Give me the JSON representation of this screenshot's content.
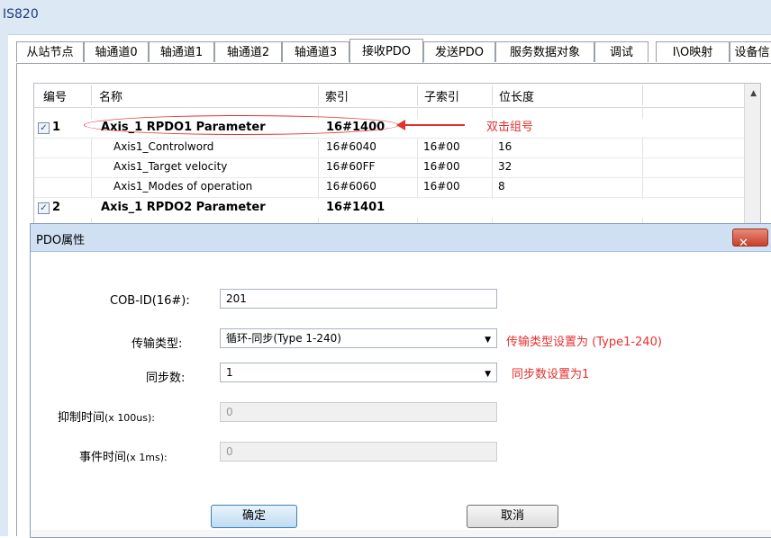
{
  "app": {
    "title": "IS820"
  },
  "tabs": [
    {
      "label": "从站节点"
    },
    {
      "label": "轴通道0"
    },
    {
      "label": "轴通道1"
    },
    {
      "label": "轴通道2"
    },
    {
      "label": "轴通道3"
    },
    {
      "label": "接收PDO",
      "active": true
    },
    {
      "label": "发送PDO"
    },
    {
      "label": "服务数据对象"
    },
    {
      "label": "调试"
    },
    {
      "label": "I\\O映射"
    },
    {
      "label": "设备信"
    }
  ],
  "table": {
    "headers": [
      "编号",
      "名称",
      "索引",
      "子索引",
      "位长度"
    ],
    "rows": [
      {
        "type": "group",
        "checked": true,
        "num": "1",
        "name": "Axis_1 RPDO1 Parameter",
        "index": "16#1400",
        "subindex": "",
        "bitlen": ""
      },
      {
        "type": "entry",
        "checked": false,
        "num": "",
        "name": "Axis1_Controlword",
        "index": "16#6040",
        "subindex": "16#00",
        "bitlen": "16"
      },
      {
        "type": "entry",
        "checked": false,
        "num": "",
        "name": "Axis1_Target velocity",
        "index": "16#60FF",
        "subindex": "16#00",
        "bitlen": "32"
      },
      {
        "type": "entry",
        "checked": false,
        "num": "",
        "name": "Axis1_Modes of operation",
        "index": "16#6060",
        "subindex": "16#00",
        "bitlen": "8"
      },
      {
        "type": "group",
        "checked": true,
        "num": "2",
        "name": "Axis_1 RPDO2 Parameter",
        "index": "16#1401",
        "subindex": "",
        "bitlen": ""
      }
    ]
  },
  "annotations": {
    "double_click": "双击组号",
    "trans_type_note": "传输类型设置为 (Type1-240)",
    "sync_note": "同步数设置为1",
    "color": "#e53030"
  },
  "dialog": {
    "title": "PDO属性",
    "close_glyph": "✕",
    "cob_id_label": "COB-ID(16#):",
    "cob_id_value": "201",
    "trans_type_label": "传输类型:",
    "trans_type_value": "循环-同步(Type 1-240)",
    "sync_label": "同步数:",
    "sync_value": "1",
    "inhibit_label": "抑制时间",
    "inhibit_unit": "(x 100us):",
    "inhibit_value": "0",
    "event_label": "事件时间",
    "event_unit": "(x 1ms):",
    "event_value": "0",
    "ok_label": "确定",
    "cancel_label": "取消"
  },
  "icons": {
    "check": "✓",
    "dropdown": "▼",
    "scroll_up": "▲"
  }
}
